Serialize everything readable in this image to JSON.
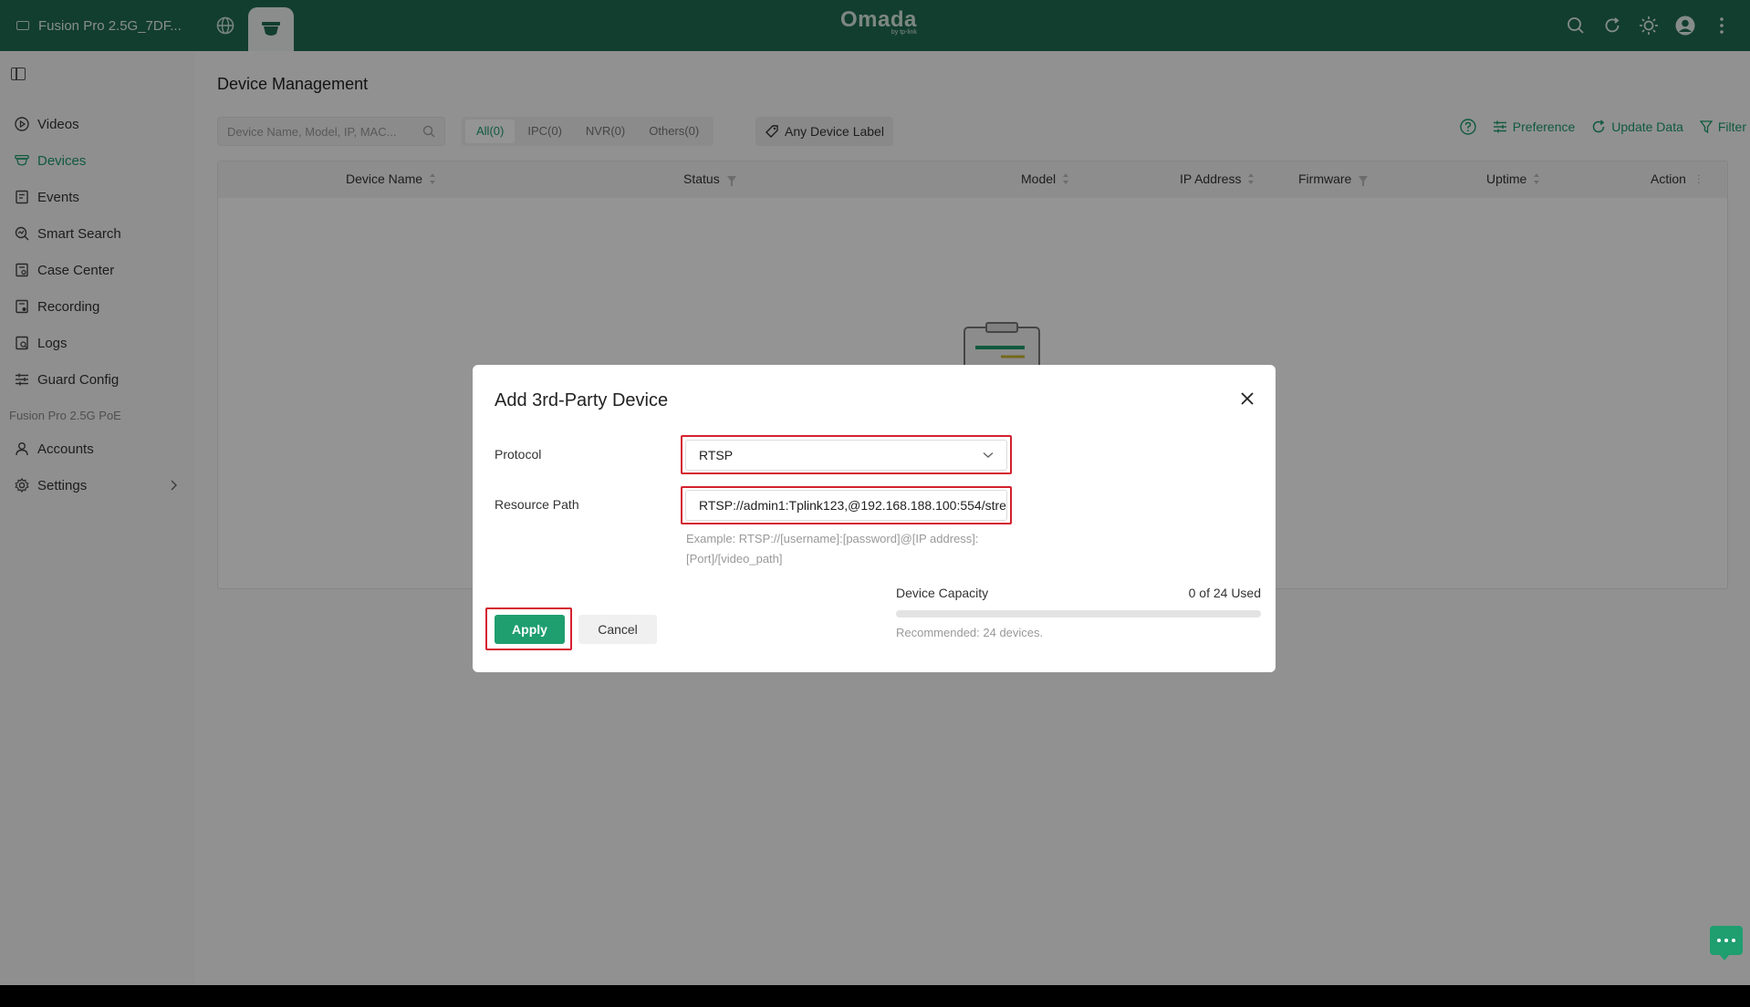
{
  "topbar": {
    "site_name": "Fusion Pro 2.5G_7DF...",
    "logo_text": "Omada",
    "logo_sub": "by tp-link",
    "brand_color": "#1f6b52"
  },
  "sidebar": {
    "items": [
      {
        "label": "Videos",
        "icon": "play-circle-icon"
      },
      {
        "label": "Devices",
        "icon": "camera-icon"
      },
      {
        "label": "Events",
        "icon": "events-icon"
      },
      {
        "label": "Smart Search",
        "icon": "smart-search-icon"
      },
      {
        "label": "Case Center",
        "icon": "case-icon"
      },
      {
        "label": "Recording",
        "icon": "recording-icon"
      },
      {
        "label": "Logs",
        "icon": "logs-icon"
      }
    ],
    "guard_config": "Guard Config",
    "section_label": "Fusion Pro 2.5G PoE",
    "accounts": "Accounts",
    "settings": "Settings"
  },
  "main": {
    "title": "Device Management",
    "search_placeholder": "Device Name, Model, IP, MAC...",
    "filters": [
      "All(0)",
      "IPC(0)",
      "NVR(0)",
      "Others(0)"
    ],
    "label_filter": "Any Device Label",
    "preference": "Preference",
    "update_data": "Update Data",
    "filter": "Filter",
    "columns": {
      "device_name": "Device Name",
      "status": "Status",
      "model": "Model",
      "ip": "IP Address",
      "firmware": "Firmware",
      "uptime": "Uptime",
      "action": "Action"
    }
  },
  "modal": {
    "title": "Add 3rd-Party Device",
    "protocol_label": "Protocol",
    "protocol_value": "RTSP",
    "resource_label": "Resource Path",
    "resource_value": "RTSP://admin1:Tplink123,@192.168.188.100:554/stre",
    "hint": "Example: RTSP://[username]:[password]@[IP address]:[Port]/[video_path]",
    "capacity_label": "Device Capacity",
    "capacity_used": "0 of 24 Used",
    "capacity_fraction": 0,
    "recommended": "Recommended: 24 devices.",
    "apply": "Apply",
    "cancel": "Cancel"
  },
  "colors": {
    "accent": "#1c9a6c",
    "highlight": "#d4202f"
  }
}
